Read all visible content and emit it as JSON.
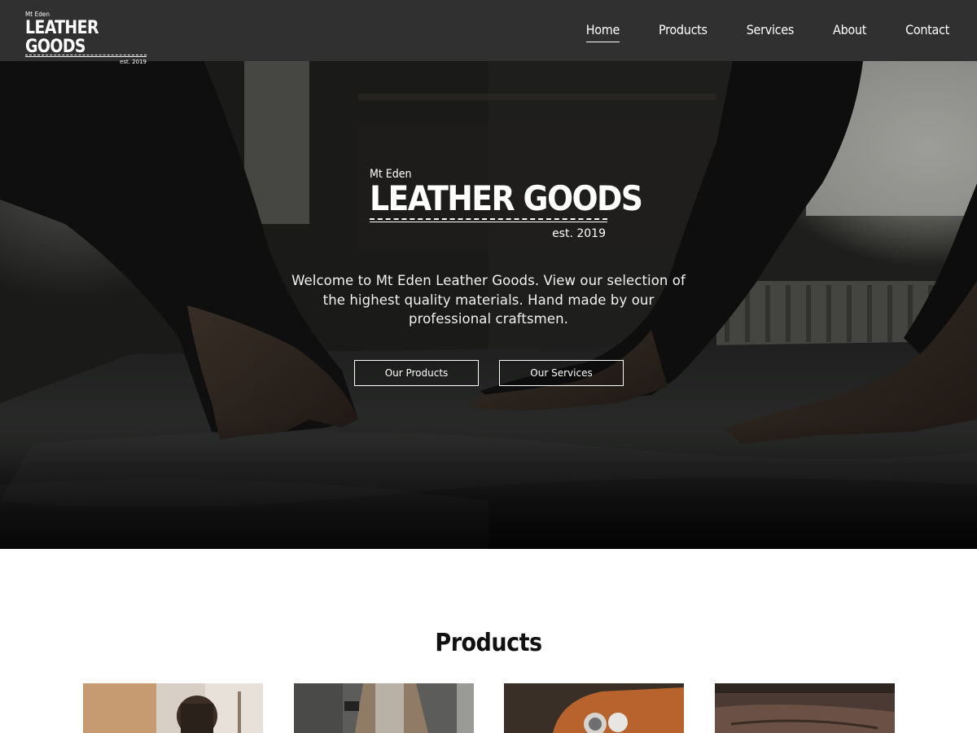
{
  "header": {
    "logo": {
      "top_text": "Mt Eden",
      "main_text": "LEATHER GOODS",
      "est_text": "est. 2019"
    },
    "nav": [
      {
        "label": "Home",
        "active": true
      },
      {
        "label": "Products",
        "active": false
      },
      {
        "label": "Services",
        "active": false
      },
      {
        "label": "About",
        "active": false
      },
      {
        "label": "Contact",
        "active": false
      }
    ]
  },
  "hero": {
    "logo": {
      "top_text": "Mt Eden",
      "main_text": "LEATHER GOODS",
      "est_text": "est. 2019"
    },
    "welcome_text": "Welcome to Mt Eden Leather Goods. View our selection of the highest quality materials. Hand made by our professional craftsmen.",
    "buttons": [
      {
        "label": "Our Products"
      },
      {
        "label": "Our Services"
      }
    ]
  },
  "products": {
    "title": "Products",
    "tiles": [
      {
        "image": "photo-product-1"
      },
      {
        "image": "photo-product-2"
      },
      {
        "image": "photo-product-3"
      },
      {
        "image": "photo-product-4"
      }
    ]
  },
  "colors": {
    "header_bg": "#303030",
    "hero_overlay": "#1c1c1b",
    "text_light": "#ffffff",
    "page_bg": "#ffffff"
  }
}
